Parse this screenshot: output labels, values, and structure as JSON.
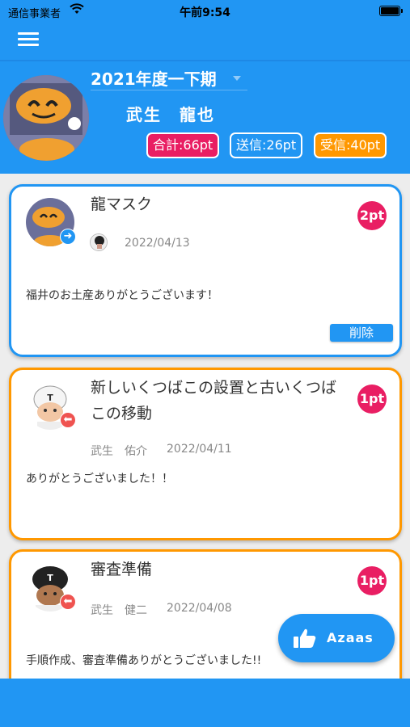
{
  "status_bar": {
    "carrier": "通信事業者",
    "time": "午前9:54"
  },
  "header": {
    "period": "2021年度一下期",
    "user_name": "武生　龍也",
    "total_pt": "合計:66pt",
    "sent_pt": "送信:26pt",
    "received_pt": "受信:40pt"
  },
  "cards": [
    {
      "title": "龍マスク",
      "points": "2pt",
      "sender": "",
      "date": "2022/04/13",
      "message": "福井のお土産ありがとうございます！",
      "direction": "sent",
      "delete_label": "削除"
    },
    {
      "title": "新しいくつばこの設置と古いくつばこの移動",
      "points": "1pt",
      "sender": "武生　佑介",
      "date": "2022/04/11",
      "message": "ありがとうございました！！",
      "direction": "received"
    },
    {
      "title": "審査準備",
      "points": "1pt",
      "sender": "武生　健二",
      "date": "2022/04/08",
      "message": "手順作成、審査準備ありがとうございました!!",
      "direction": "received"
    }
  ],
  "fab": {
    "label": "Azaas",
    "icon": "thumbs-up-icon"
  },
  "colors": {
    "primary": "#2196f3",
    "total": "#e91e63",
    "received": "#ff9800"
  }
}
